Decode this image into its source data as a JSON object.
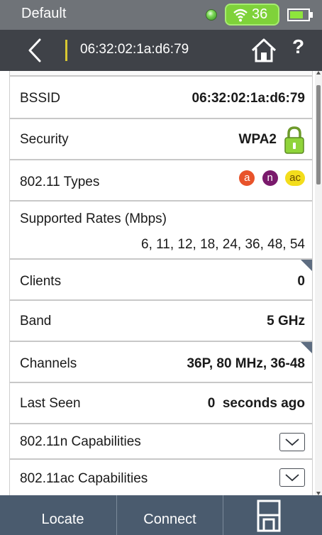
{
  "status_bar": {
    "title": "Default",
    "wifi_value": "36",
    "battery_level": 0.75,
    "colors": {
      "background": "#6f7378",
      "wifi_pill": "#7fd23a",
      "battery_fill": "#8ee43c"
    }
  },
  "nav": {
    "title": "06:32:02:1a:d6:79",
    "back_icon": "chevron-left-icon",
    "home_icon": "home-icon",
    "help_label": "?"
  },
  "details": {
    "bssid": {
      "label": "BSSID",
      "value": "06:32:02:1a:d6:79"
    },
    "security": {
      "label": "Security",
      "value": "WPA2",
      "icon": "lock-icon"
    },
    "types": {
      "label": "802.11 Types",
      "badges": [
        "a",
        "n",
        "ac"
      ]
    },
    "rates": {
      "label": "Supported Rates (Mbps)",
      "value": "6, 11, 12, 18, 24, 36, 48, 54"
    },
    "clients": {
      "label": "Clients",
      "value": "0"
    },
    "band": {
      "label": "Band",
      "value": "5 GHz"
    },
    "channels": {
      "label": "Channels",
      "value": "36P, 80 MHz, 36-48"
    },
    "last_seen": {
      "label": "Last Seen",
      "value": "0  seconds ago"
    },
    "n_caps": {
      "label": "802.11n Capabilities"
    },
    "ac_caps": {
      "label": "802.11ac Capabilities"
    }
  },
  "toolbar": {
    "locate_label": "Locate",
    "connect_label": "Connect",
    "save_icon": "save-icon"
  }
}
